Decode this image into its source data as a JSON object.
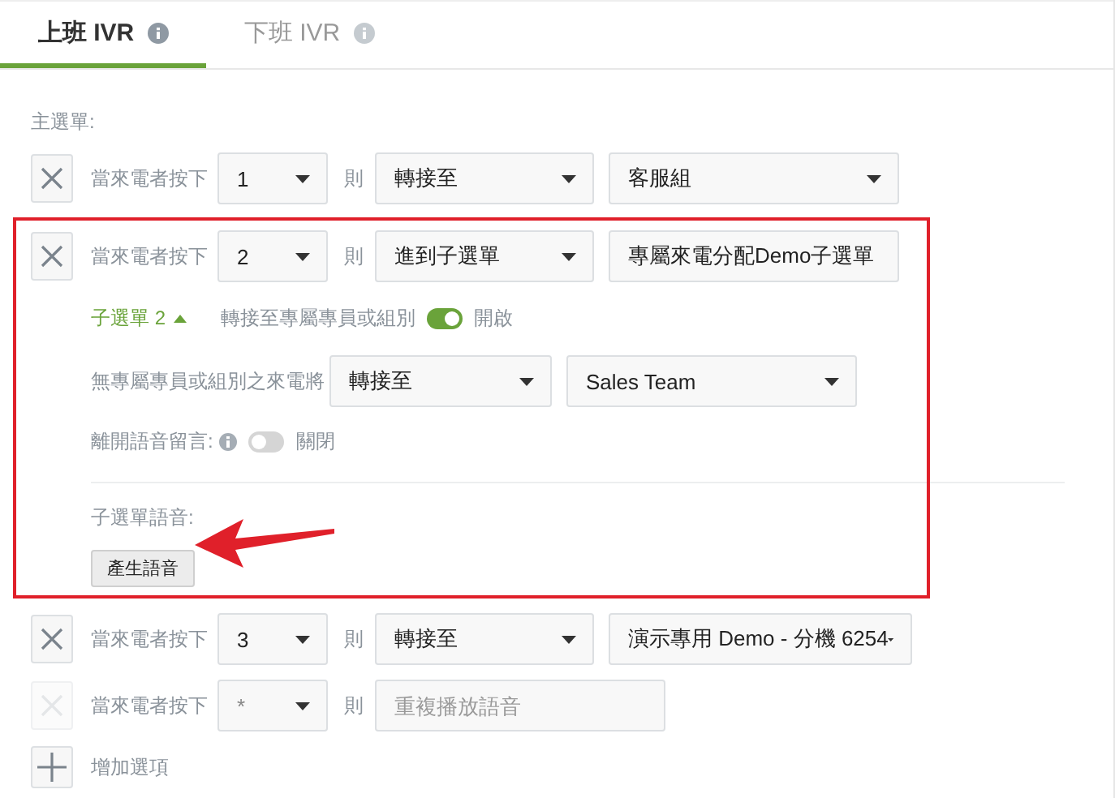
{
  "tabs": [
    {
      "label": "上班 IVR",
      "selected": true
    },
    {
      "label": "下班 IVR",
      "selected": false
    }
  ],
  "main_menu": {
    "label": "主選單:"
  },
  "options": [
    {
      "prefix": "當來電者按下",
      "key": "1",
      "then": "則",
      "action": {
        "kind": "select",
        "text": "轉接至"
      },
      "target": {
        "kind": "select",
        "text": "客服組"
      },
      "removable": true,
      "highlighted": false
    },
    {
      "prefix": "當來電者按下",
      "key": "2",
      "then": "則",
      "action": {
        "kind": "select",
        "text": "進到子選單"
      },
      "target": {
        "kind": "field",
        "text": "專屬來電分配Demo子選單"
      },
      "removable": true,
      "highlighted": true,
      "submenu": {
        "title": "子選單 2",
        "expanded": true,
        "route_label": "轉接至專屬專員或組別",
        "route_on": true,
        "route_state": "開啟",
        "fallback_label": "無專屬專員或組別之來電將",
        "fallback_action": "轉接至",
        "fallback_target": "Sales Team",
        "voicemail_label": "離開語音留言:",
        "voicemail_on": false,
        "voicemail_state": "關閉",
        "voice_label": "子選單語音:",
        "generate_button": "產生語音"
      }
    },
    {
      "prefix": "當來電者按下",
      "key": "3",
      "then": "則",
      "action": {
        "kind": "select",
        "text": "轉接至"
      },
      "target": {
        "kind": "select",
        "text": "演示專用 Demo - 分機 6254"
      },
      "removable": true,
      "highlighted": false
    },
    {
      "prefix": "當來電者按下",
      "key": "*",
      "then": "則",
      "action": {
        "kind": "field",
        "placeholder": "重複播放語音"
      },
      "removable": false,
      "highlighted": false
    }
  ],
  "add_option": {
    "label": "增加選項"
  }
}
